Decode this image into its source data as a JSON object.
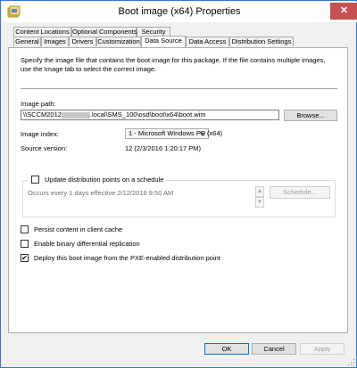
{
  "window": {
    "title": "Boot image (x64) Properties",
    "close_glyph": "✕"
  },
  "tabs_row1": [
    {
      "label": "Content Locations"
    },
    {
      "label": "Optional Components"
    },
    {
      "label": "Security"
    }
  ],
  "tabs_row2": [
    {
      "label": "General"
    },
    {
      "label": "Images"
    },
    {
      "label": "Drivers"
    },
    {
      "label": "Customization"
    },
    {
      "label": "Data Source",
      "active": true
    },
    {
      "label": "Data Access"
    },
    {
      "label": "Distribution Settings"
    }
  ],
  "panel": {
    "description": "Specify the image file that contains the boot image for this package. If the file contains multiple images, use the Image tab to select the correct image.",
    "image_path_label": "Image path:",
    "image_path_value_prefix": "\\\\SCCM2012",
    "image_path_value_suffix": ".local\\SMS_100\\osd\\boot\\x64\\boot.wim",
    "browse_label": "Browse...",
    "image_index_label": "Image index:",
    "image_index_value": "1 - Microsoft Windows PE (x64)",
    "source_version_label": "Source version:",
    "source_version_value": "12 (2/3/2016 1:20:17 PM)",
    "schedule_checkbox_label": "Update distribution points on a schedule",
    "schedule_text": "Occurs every 1 days effective 2/12/2016 9:50 AM",
    "schedule_button_label": "Schedule...",
    "persist_label": "Persist content in client cache",
    "binary_diff_label": "Enable binary differential replication",
    "deploy_pxe_label": "Deploy this boot image from the PXE-enabled distribution point",
    "check_glyph": "✔"
  },
  "footer": {
    "ok_label": "OK",
    "cancel_label": "Cancel",
    "apply_label": "Apply"
  }
}
